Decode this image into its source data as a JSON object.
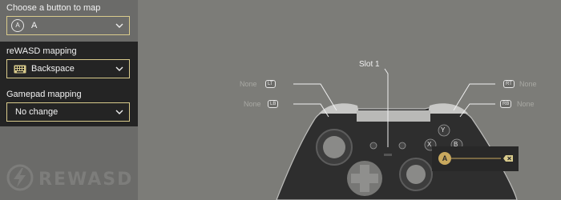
{
  "panel": {
    "choose_label": "Choose a button to map",
    "choose_value": "A",
    "choose_icon_letter": "A",
    "rewasd_label": "reWASD mapping",
    "rewasd_value": "Backspace",
    "gamepad_label": "Gamepad mapping",
    "gamepad_value": "No change"
  },
  "logo": {
    "text": "REWASD"
  },
  "controller": {
    "slot_label": "Slot 1",
    "lt_tag": "LT",
    "lb_tag": "LB",
    "rt_tag": "RT",
    "rb_tag": "RB",
    "lt_value": "None",
    "lb_value": "None",
    "rt_value": "None",
    "rb_value": "None",
    "face_y": "Y",
    "face_x": "X",
    "face_b": "B",
    "face_a": "A"
  },
  "assignment": {
    "button": "A",
    "icon": "backspace-icon"
  },
  "colors": {
    "accent": "#d9cb8c",
    "a_button": "#c9a95e",
    "dark_panel": "#242424"
  }
}
